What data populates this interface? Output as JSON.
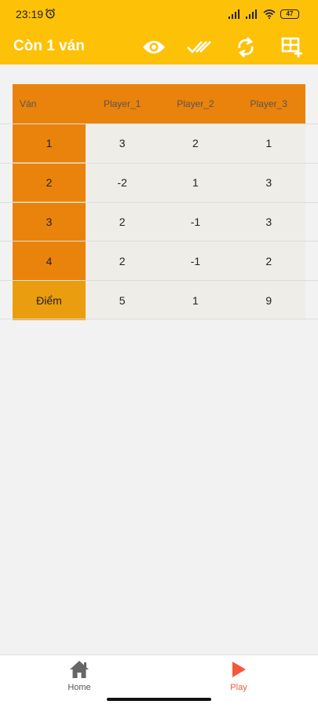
{
  "status_bar": {
    "time": "23:19",
    "battery": "47",
    "alarm_icon": "alarm-clock-icon",
    "signal_icon": "cell-signal-icon",
    "wifi_icon": "wifi-icon"
  },
  "app_bar": {
    "title": "Còn 1 ván",
    "background": "#fdc107",
    "actions": [
      {
        "name": "eye-icon"
      },
      {
        "name": "double-check-icon"
      },
      {
        "name": "refresh-icon"
      },
      {
        "name": "add-table-icon"
      }
    ]
  },
  "table": {
    "headers": [
      "Ván",
      "Player_1",
      "Player_2",
      "Player_3"
    ],
    "rows": [
      {
        "label": "1",
        "values": [
          "3",
          "2",
          "1"
        ]
      },
      {
        "label": "2",
        "values": [
          "-2",
          "1",
          "3"
        ]
      },
      {
        "label": "3",
        "values": [
          "2",
          "-1",
          "3"
        ]
      },
      {
        "label": "4",
        "values": [
          "2",
          "-1",
          "2"
        ]
      }
    ],
    "total": {
      "label": "Điểm",
      "values": [
        "5",
        "1",
        "9"
      ]
    },
    "header_color": "#ea830b",
    "total_color": "#eb9d10"
  },
  "bottom_nav": {
    "items": [
      {
        "label": "Home",
        "icon": "home-icon",
        "active": false
      },
      {
        "label": "Play",
        "icon": "play-icon",
        "active": true
      }
    ],
    "active_color": "#f4593a"
  }
}
